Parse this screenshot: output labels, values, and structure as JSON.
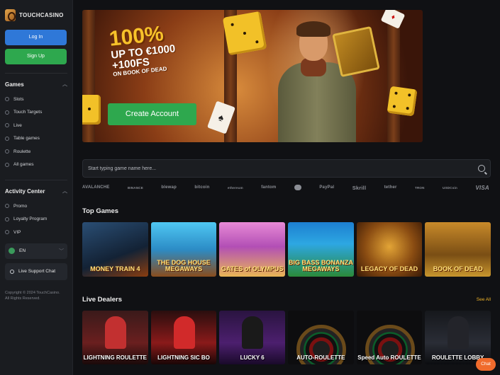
{
  "brand": {
    "name": "TOUCHCASINO"
  },
  "auth": {
    "login_label": "Log In",
    "signup_label": "Sign Up"
  },
  "sidebar": {
    "games_title": "Games",
    "games": [
      {
        "label": "Slots",
        "icon": "slots-icon"
      },
      {
        "label": "Touch Targets",
        "icon": "target-icon"
      },
      {
        "label": "Live",
        "icon": "live-icon"
      },
      {
        "label": "Table games",
        "icon": "cards-icon"
      },
      {
        "label": "Roulette",
        "icon": "roulette-icon"
      },
      {
        "label": "All games",
        "icon": "grid-icon"
      }
    ],
    "activity_title": "Activity Center",
    "activity": [
      {
        "label": "Promo",
        "icon": "gift-icon"
      },
      {
        "label": "Loyalty Program",
        "icon": "star-icon"
      },
      {
        "label": "VIP",
        "icon": "crown-icon"
      }
    ],
    "language": "EN",
    "support_label": "Live Support Chat",
    "copyright_line1": "Copyright © 2024 TouchCasino.",
    "copyright_line2": "All Rights Reserved."
  },
  "banner": {
    "headline": "100%",
    "line2": "UP TO €1000",
    "line3": "+100FS",
    "line4": "ON BOOK OF DEAD",
    "cta_label": "Create Account"
  },
  "search": {
    "placeholder": "Start typing game name here..."
  },
  "payments": [
    "AVALANCHE",
    "BINANCE",
    "blewap",
    "bitcoin",
    "ethereum",
    "fantom",
    "",
    "PayPal",
    "Skrill",
    "tether",
    "TRON",
    "USDCoin",
    "VISA"
  ],
  "top_games": {
    "title": "Top Games",
    "items": [
      {
        "name": "MONEY TRAIN 4"
      },
      {
        "name": "THE DOG HOUSE MEGAWAYS"
      },
      {
        "name": "GATES of OLYMPUS"
      },
      {
        "name": "BIG BASS BONANZA MEGAWAYS"
      },
      {
        "name": "LEGACY OF DEAD"
      },
      {
        "name": "BOOK OF DEAD"
      }
    ]
  },
  "live_dealers": {
    "title": "Live Dealers",
    "see_all": "See All",
    "items": [
      {
        "name": "LIGHTNING ROULETTE"
      },
      {
        "name": "LIGHTNING SIC BO"
      },
      {
        "name": "LUCKY 6"
      },
      {
        "name": "AUTO-ROULETTE"
      },
      {
        "name": "Speed Auto ROULETTE"
      },
      {
        "name": "ROULETTE LOBBY"
      }
    ]
  },
  "chat_label": "Chat",
  "colors": {
    "accent_blue": "#2f78d8",
    "accent_green": "#2ea84e",
    "gold": "#f0b429",
    "chat": "#f06b2c"
  }
}
